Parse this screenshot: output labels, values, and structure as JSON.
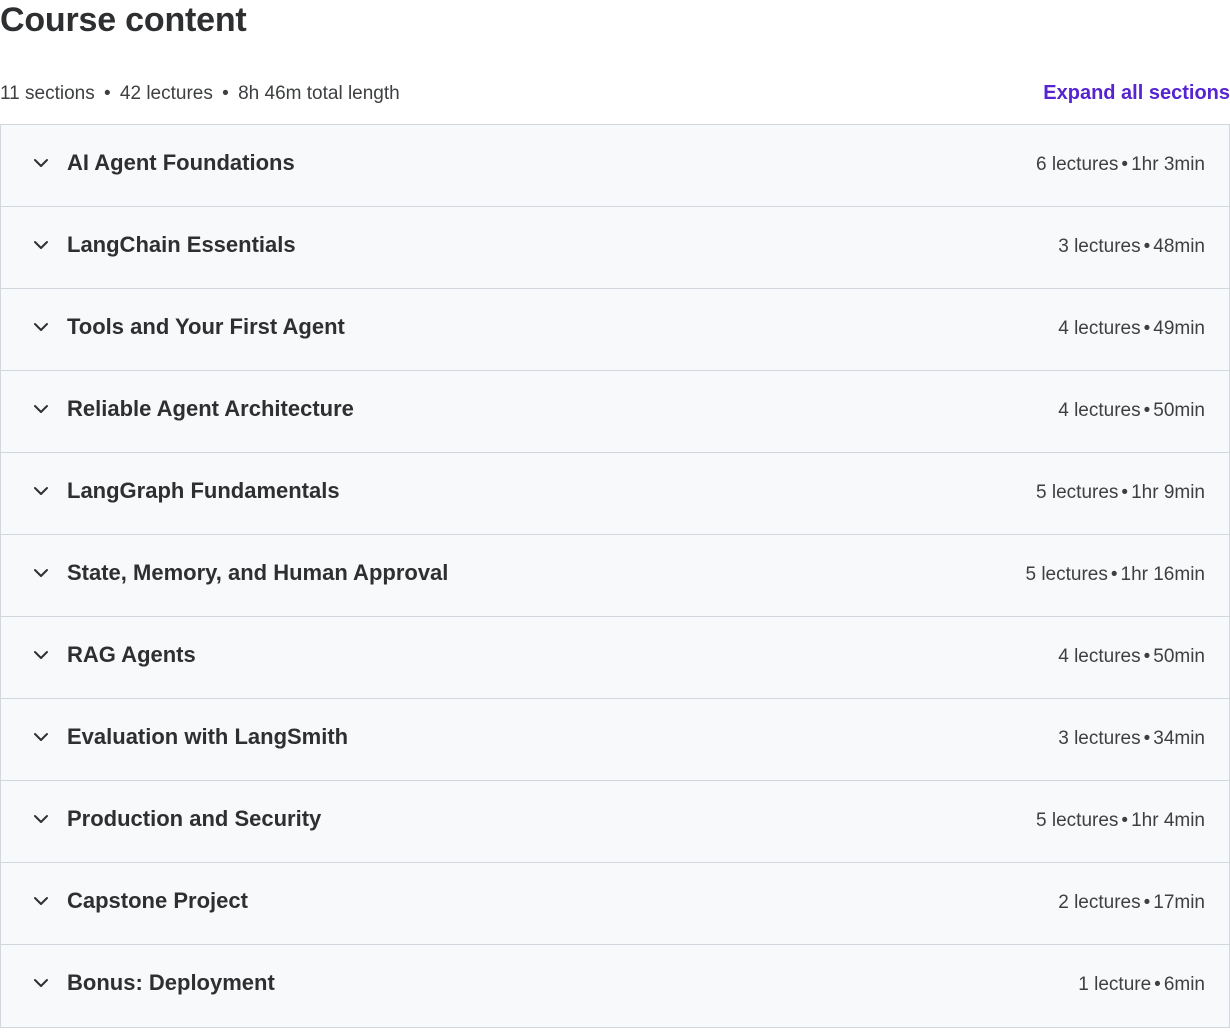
{
  "header": {
    "title": "Course content"
  },
  "summary": {
    "sections": "11 sections",
    "lectures": "42 lectures",
    "length": "8h 46m total length",
    "separator": "•",
    "expand_label": "Expand all sections"
  },
  "colors": {
    "accent": "#5624d0",
    "row_background": "#f7f9fa",
    "border": "#d1d7dc",
    "text": "#2d2f31"
  },
  "icons": {
    "section_toggle": "chevron-down-icon"
  },
  "sections": [
    {
      "title": "AI Agent Foundations",
      "lectures": "6 lectures",
      "duration": "1hr 3min"
    },
    {
      "title": "LangChain Essentials",
      "lectures": "3 lectures",
      "duration": "48min"
    },
    {
      "title": "Tools and Your First Agent",
      "lectures": "4 lectures",
      "duration": "49min"
    },
    {
      "title": "Reliable Agent Architecture",
      "lectures": "4 lectures",
      "duration": "50min"
    },
    {
      "title": "LangGraph Fundamentals",
      "lectures": "5 lectures",
      "duration": "1hr 9min"
    },
    {
      "title": "State, Memory, and Human Approval",
      "lectures": "5 lectures",
      "duration": "1hr 16min"
    },
    {
      "title": "RAG Agents",
      "lectures": "4 lectures",
      "duration": "50min"
    },
    {
      "title": "Evaluation with LangSmith",
      "lectures": "3 lectures",
      "duration": "34min"
    },
    {
      "title": "Production and Security",
      "lectures": "5 lectures",
      "duration": "1hr 4min"
    },
    {
      "title": "Capstone Project",
      "lectures": "2 lectures",
      "duration": "17min"
    },
    {
      "title": "Bonus: Deployment",
      "lectures": "1 lecture",
      "duration": "6min"
    }
  ]
}
